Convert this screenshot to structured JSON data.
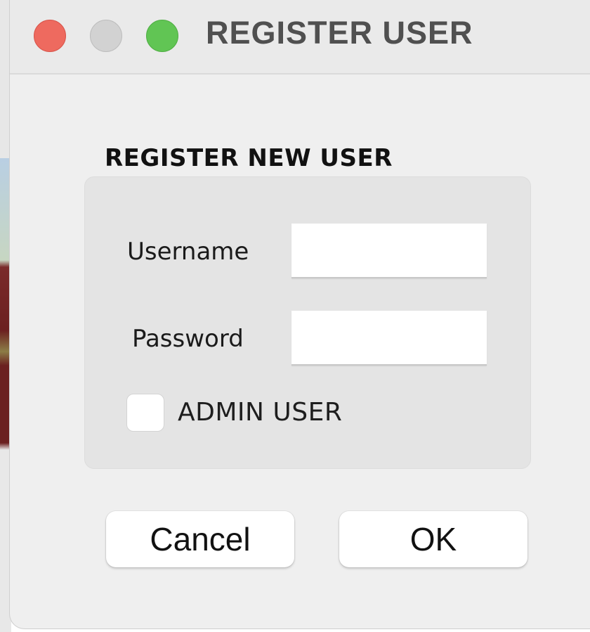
{
  "window": {
    "title": "REGISTER USER",
    "controls": {
      "close_color": "#ee6a5f",
      "minimize_color": "#d2d2d2",
      "zoom_color": "#61c554"
    }
  },
  "form": {
    "group_title": "REGISTER NEW USER",
    "username": {
      "label": "Username",
      "value": "",
      "placeholder": ""
    },
    "password": {
      "label": "Password",
      "value": "",
      "placeholder": ""
    },
    "admin_checkbox": {
      "label": "ADMIN USER",
      "checked": false
    }
  },
  "buttons": {
    "cancel_label": "Cancel",
    "ok_label": "OK"
  }
}
